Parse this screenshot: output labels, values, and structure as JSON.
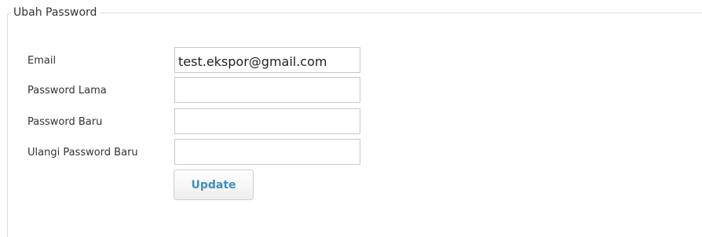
{
  "form": {
    "legend": "Ubah Password",
    "fields": [
      {
        "label": "Email",
        "value": "test.ekspor@gmail.com",
        "type": "text"
      },
      {
        "label": "Password Lama",
        "value": "",
        "type": "password"
      },
      {
        "label": "Password Baru",
        "value": "",
        "type": "password"
      },
      {
        "label": "Ulangi Password Baru",
        "value": "",
        "type": "password"
      }
    ],
    "submit_label": "Update"
  },
  "colors": {
    "border": "#d9dde3",
    "button_text": "#3f8fc0"
  }
}
